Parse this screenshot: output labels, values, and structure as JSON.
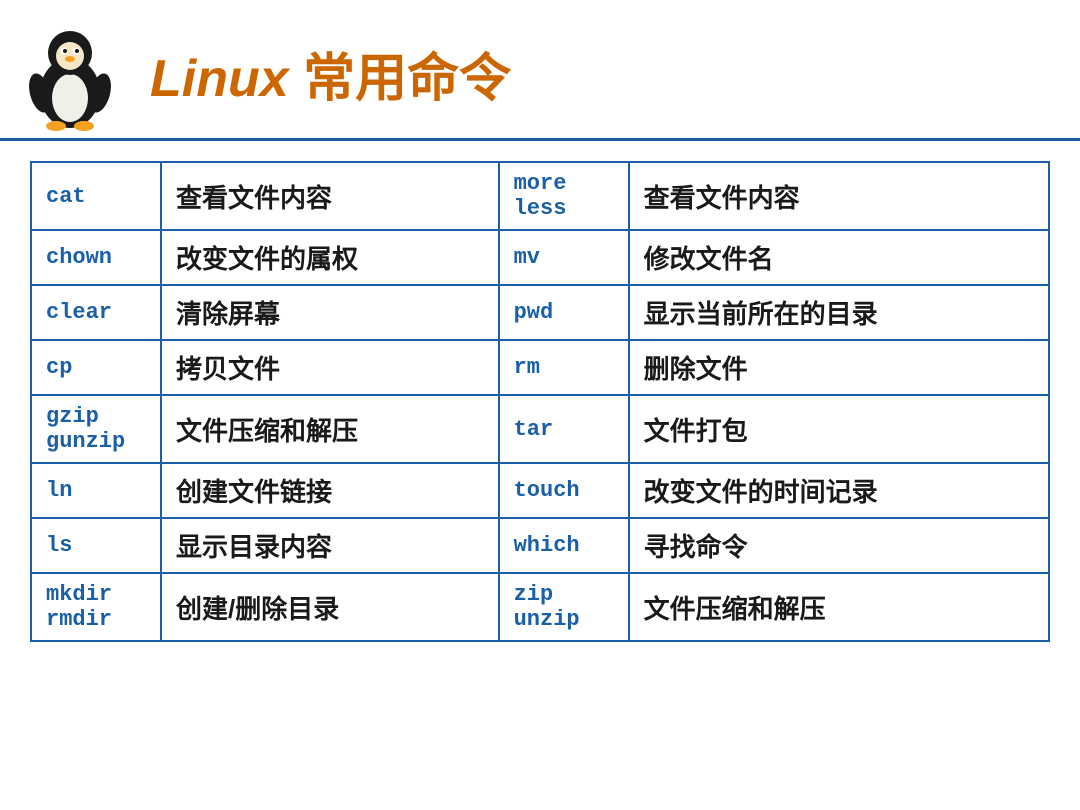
{
  "header": {
    "title_en": "Linux",
    "title_cn": "常用命令"
  },
  "table": {
    "rows": [
      {
        "cmd1": "cat",
        "desc1": "查看文件内容",
        "cmd2": "more\nless",
        "desc2": "查看文件内容"
      },
      {
        "cmd1": "chown",
        "desc1": "改变文件的属权",
        "cmd2": "mv",
        "desc2": "修改文件名"
      },
      {
        "cmd1": "clear",
        "desc1": "清除屏幕",
        "cmd2": "pwd",
        "desc2": "显示当前所在的目录"
      },
      {
        "cmd1": "cp",
        "desc1": "拷贝文件",
        "cmd2": "rm",
        "desc2": "删除文件"
      },
      {
        "cmd1": "gzip\ngunzip",
        "desc1": "文件压缩和解压",
        "cmd2": "tar",
        "desc2": "文件打包"
      },
      {
        "cmd1": "ln",
        "desc1": "创建文件链接",
        "cmd2": "touch",
        "desc2": "改变文件的时间记录"
      },
      {
        "cmd1": "ls",
        "desc1": "显示目录内容",
        "cmd2": "which",
        "desc2": "寻找命令"
      },
      {
        "cmd1": "mkdir\nrmdir",
        "desc1": "创建/删除目录",
        "cmd2": "zip\nunzip",
        "desc2": "文件压缩和解压"
      }
    ]
  }
}
